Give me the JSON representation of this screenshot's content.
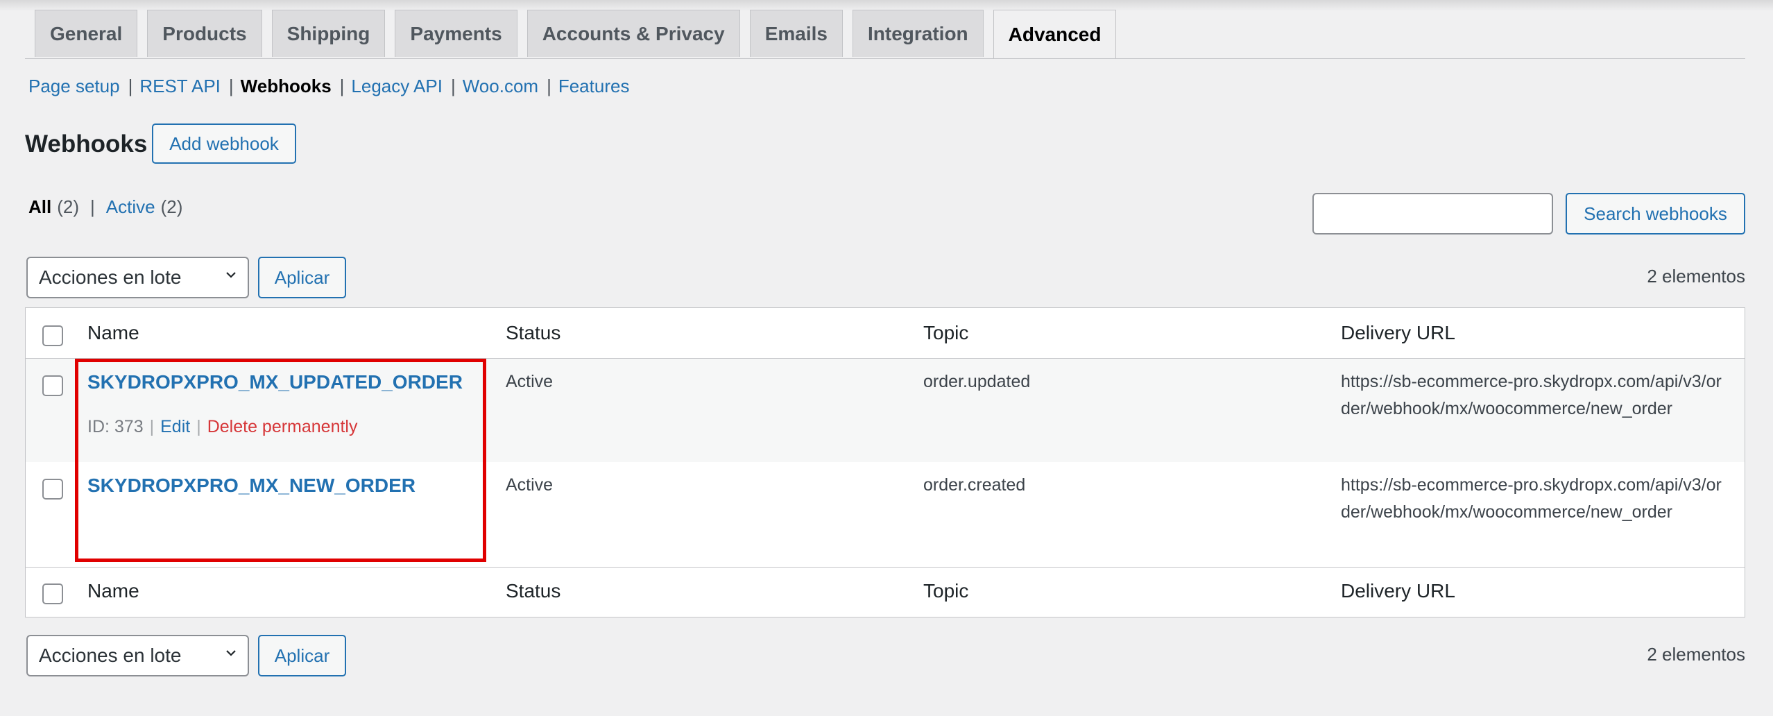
{
  "tabs": [
    "General",
    "Products",
    "Shipping",
    "Payments",
    "Accounts & Privacy",
    "Emails",
    "Integration",
    "Advanced"
  ],
  "subnav": {
    "page_setup": "Page setup",
    "rest_api": "REST API",
    "webhooks": "Webhooks",
    "legacy_api": "Legacy API",
    "woo_com": "Woo.com",
    "features": "Features",
    "sep": "|"
  },
  "header": {
    "title": "Webhooks",
    "add_button": "Add webhook"
  },
  "filters": {
    "all_label": "All",
    "all_count": "(2)",
    "active_label": "Active",
    "active_count": "(2)",
    "sep": "|"
  },
  "search": {
    "value": "",
    "button": "Search webhooks"
  },
  "bulk": {
    "selected": "Acciones en lote",
    "apply": "Aplicar",
    "count": "2 elementos"
  },
  "table": {
    "columns": {
      "name": "Name",
      "status": "Status",
      "topic": "Topic",
      "delivery_url": "Delivery URL"
    },
    "rows": [
      {
        "name": "SKYDROPXPRO_MX_UPDATED_ORDER",
        "id_label": "ID: 373",
        "edit": "Edit",
        "delete": "Delete permanently",
        "status": "Active",
        "topic": "order.updated",
        "url": "https://sb-ecommerce-pro.skydropx.com/api/v3/order/webhook/mx/woocommerce/new_order"
      },
      {
        "name": "SKYDROPXPRO_MX_NEW_ORDER",
        "status": "Active",
        "topic": "order.created",
        "url": "https://sb-ecommerce-pro.skydropx.com/api/v3/order/webhook/mx/woocommerce/new_order"
      }
    ]
  },
  "colors": {
    "link": "#2271b1",
    "delete": "#d63638",
    "highlight": "#e00000",
    "background": "#f0f0f1"
  }
}
